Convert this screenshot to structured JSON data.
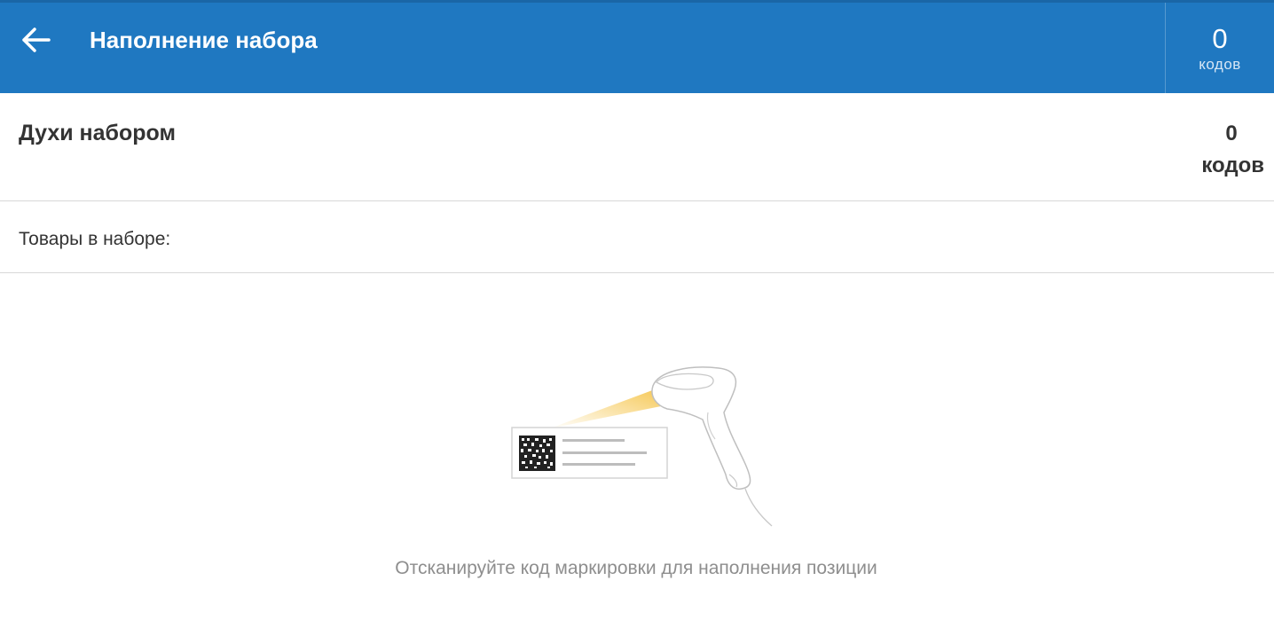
{
  "header": {
    "title": "Наполнение набора",
    "counter": {
      "value": "0",
      "unit": "кодов"
    },
    "back_icon": "arrow-left-icon",
    "background_color": "#1f78c1"
  },
  "product": {
    "name": "Духи набором",
    "count": "0",
    "count_unit": "кодов"
  },
  "section": {
    "label": "Товары в наборе:"
  },
  "empty_state": {
    "illustration_icon": "barcode-scanner-icon",
    "hint": "Отсканируйте код маркировки для наполнения позиции"
  }
}
